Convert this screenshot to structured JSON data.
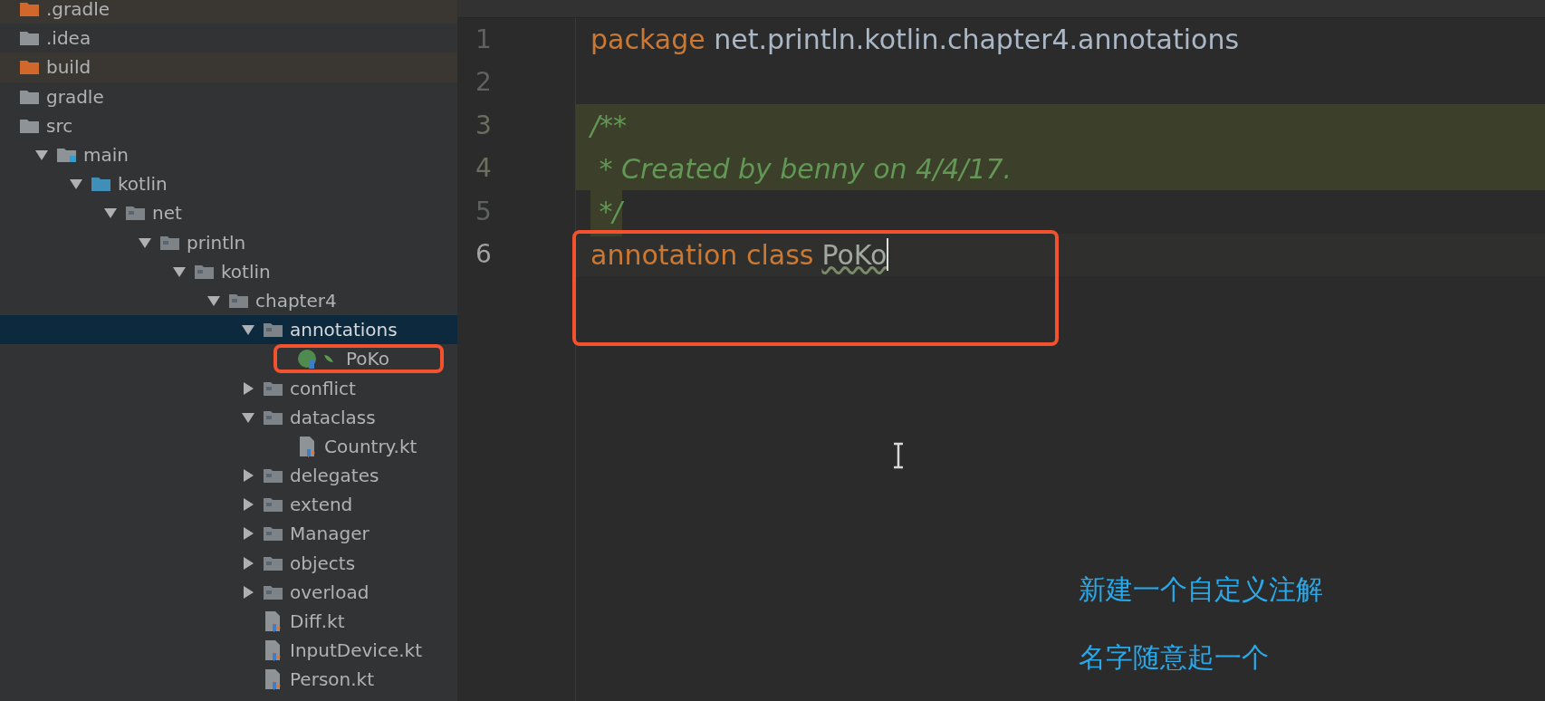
{
  "project_tree": [
    {
      "label": ".gradle",
      "kind": "excluded_folder",
      "selected": false
    },
    {
      "label": ".idea",
      "kind": "folder",
      "selected": false
    },
    {
      "label": "build",
      "kind": "excluded_folder",
      "selected": false
    },
    {
      "label": "gradle",
      "kind": "folder",
      "selected": false
    },
    {
      "label": "src",
      "kind": "folder",
      "selected": false,
      "children": [
        {
          "label": "main",
          "kind": "module_folder",
          "selected": false,
          "expanded": true,
          "children": [
            {
              "label": "kotlin",
              "kind": "source_folder",
              "selected": false,
              "expanded": true,
              "children": [
                {
                  "label": "net",
                  "kind": "package",
                  "selected": false,
                  "expanded": true,
                  "children": [
                    {
                      "label": "println",
                      "kind": "package",
                      "selected": false,
                      "expanded": true,
                      "children": [
                        {
                          "label": "kotlin",
                          "kind": "package",
                          "selected": false,
                          "expanded": true,
                          "children": [
                            {
                              "label": "chapter4",
                              "kind": "package",
                              "selected": false,
                              "expanded": true,
                              "children": [
                                {
                                  "label": "annotations",
                                  "kind": "package",
                                  "selected": true,
                                  "expanded": true,
                                  "children": [
                                    {
                                      "label": "PoKo",
                                      "kind": "annotation_class",
                                      "selected": false
                                    }
                                  ]
                                },
                                {
                                  "label": "conflict",
                                  "kind": "package",
                                  "selected": false,
                                  "expanded": false
                                },
                                {
                                  "label": "dataclass",
                                  "kind": "package",
                                  "selected": false,
                                  "expanded": true,
                                  "children": [
                                    {
                                      "label": "Country.kt",
                                      "kind": "kotlin_file",
                                      "selected": false
                                    }
                                  ]
                                },
                                {
                                  "label": "delegates",
                                  "kind": "package",
                                  "selected": false,
                                  "expanded": false
                                },
                                {
                                  "label": "extend",
                                  "kind": "package",
                                  "selected": false,
                                  "expanded": false
                                },
                                {
                                  "label": "Manager",
                                  "kind": "package",
                                  "selected": false,
                                  "expanded": false
                                },
                                {
                                  "label": "objects",
                                  "kind": "package",
                                  "selected": false,
                                  "expanded": false
                                },
                                {
                                  "label": "overload",
                                  "kind": "package",
                                  "selected": false,
                                  "expanded": false
                                },
                                {
                                  "label": "Diff.kt",
                                  "kind": "kotlin_file",
                                  "selected": false
                                },
                                {
                                  "label": "InputDevice.kt",
                                  "kind": "kotlin_file",
                                  "selected": false
                                },
                                {
                                  "label": "Person.kt",
                                  "kind": "kotlin_file",
                                  "selected": false
                                }
                              ]
                            }
                          ]
                        }
                      ]
                    }
                  ]
                }
              ]
            }
          ]
        }
      ]
    }
  ],
  "editor": {
    "lines": [
      {
        "number": "1",
        "highlighted": false,
        "current": false,
        "tokens": [
          {
            "text": "package",
            "kind": "keyword"
          },
          {
            "text": " net.println.kotlin.chapter4.annotations",
            "kind": "plain"
          }
        ]
      },
      {
        "number": "2",
        "highlighted": false,
        "current": false
      },
      {
        "number": "3",
        "highlighted": true,
        "current": false,
        "tokens": [
          {
            "text": "/**",
            "kind": "comment"
          }
        ]
      },
      {
        "number": "4",
        "highlighted": true,
        "current": false,
        "tokens": [
          {
            "text": " * Created by benny on 4/4/17.",
            "kind": "comment"
          }
        ]
      },
      {
        "number": "5",
        "highlighted": false,
        "current": false,
        "tokens": [
          {
            "text": " */",
            "kind": "comment"
          }
        ]
      },
      {
        "number": "6",
        "highlighted": false,
        "current": true,
        "tokens": [
          {
            "text": "annotation class",
            "kind": "keyword"
          },
          {
            "text": "PoKo",
            "kind": "warning"
          }
        ]
      }
    ]
  },
  "captions": [
    "新建一个自定义注解",
    "名字随意起一个"
  ]
}
